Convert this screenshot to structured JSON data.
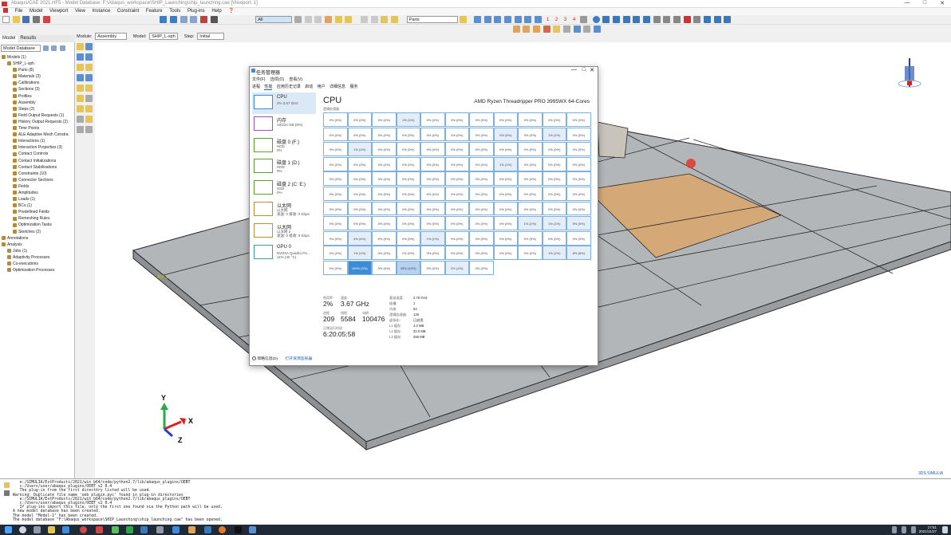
{
  "window": {
    "title": "Abaqus/CAE 2021.HF5 - Model Database: F:\\Abaqus_workspace\\SHIP_Launching\\ship_launching.cae [Viewport: 1]",
    "controls": [
      "—",
      "□",
      "✕"
    ]
  },
  "menu": [
    "File",
    "Model",
    "Viewport",
    "View",
    "Instance",
    "Constraint",
    "Feature",
    "Tools",
    "Plug-ins",
    "Help",
    "❓"
  ],
  "toolbar": {
    "filter_value": "All",
    "parts_value": "Parts",
    "view_numbers": [
      "1",
      "2",
      "3",
      "4"
    ]
  },
  "module_bar": {
    "module_label": "Module:",
    "module_value": "Assembly",
    "model_label": "Model:",
    "model_value": "SHIP_L-sph",
    "step_label": "Step:",
    "step_value": "Initial"
  },
  "tree": {
    "tabs": [
      "Model",
      "Results"
    ],
    "dropdown": "Model Database",
    "items": [
      {
        "label": "Models (1)",
        "indent": 0
      },
      {
        "label": "SHIP_L-sph",
        "indent": 1
      },
      {
        "label": "Parts (8)",
        "indent": 2
      },
      {
        "label": "Materials (3)",
        "indent": 2
      },
      {
        "label": "Calibrations",
        "indent": 2
      },
      {
        "label": "Sections (3)",
        "indent": 2
      },
      {
        "label": "Profiles",
        "indent": 2
      },
      {
        "label": "Assembly",
        "indent": 2
      },
      {
        "label": "Steps (2)",
        "indent": 2
      },
      {
        "label": "Field Output Requests (1)",
        "indent": 2
      },
      {
        "label": "History Output Requests (2)",
        "indent": 2
      },
      {
        "label": "Time Points",
        "indent": 2
      },
      {
        "label": "ALE Adaptive Mesh Constra",
        "indent": 2
      },
      {
        "label": "Interactions (1)",
        "indent": 2
      },
      {
        "label": "Interaction Properties (3)",
        "indent": 2
      },
      {
        "label": "Contact Controls",
        "indent": 2
      },
      {
        "label": "Contact Initializations",
        "indent": 2
      },
      {
        "label": "Contact Stabilizations",
        "indent": 2
      },
      {
        "label": "Constraints (10)",
        "indent": 2
      },
      {
        "label": "Connector Sections",
        "indent": 2
      },
      {
        "label": "Fields",
        "indent": 2
      },
      {
        "label": "Amplitudes",
        "indent": 2
      },
      {
        "label": "Loads (1)",
        "indent": 2
      },
      {
        "label": "BCs (1)",
        "indent": 2
      },
      {
        "label": "Predefined Fields",
        "indent": 2
      },
      {
        "label": "Remeshing Rules",
        "indent": 2
      },
      {
        "label": "Optimization Tasks",
        "indent": 2
      },
      {
        "label": "Sketches (2)",
        "indent": 2
      },
      {
        "label": "Annotations",
        "indent": 0
      },
      {
        "label": "Analysis",
        "indent": 0
      },
      {
        "label": "Jobs (1)",
        "indent": 1
      },
      {
        "label": "Adaptivity Processes",
        "indent": 1
      },
      {
        "label": "Co-executions",
        "indent": 1
      },
      {
        "label": "Optimization Processes",
        "indent": 1
      }
    ]
  },
  "viewport": {
    "triad": {
      "x": "X",
      "y": "Y",
      "z": "Z"
    },
    "label_ref": "JFP-1",
    "logo": "3DS SIMULIA",
    "colors": {
      "plate": "#b3b6b8",
      "highlight": "#d5a877",
      "edge": "#2a2a2a",
      "marker": "#e23a2a"
    }
  },
  "task_manager": {
    "title": "任务管理器",
    "menu": [
      "文件(F)",
      "选项(O)",
      "查看(V)"
    ],
    "tabs": [
      "进程",
      "性能",
      "应用历史记录",
      "启动",
      "用户",
      "详细信息",
      "服务"
    ],
    "side": [
      {
        "name": "CPU",
        "s1": "2% 3.67 GHz",
        "s2": ""
      },
      {
        "name": "内存",
        "s1": "19/224 GB (9%)",
        "s2": ""
      },
      {
        "name": "磁盘 0 (F:)",
        "s1": "HDD",
        "s2": "0%"
      },
      {
        "name": "磁盘 1 (D:)",
        "s1": "HDD",
        "s2": "0%"
      },
      {
        "name": "磁盘 2 (C: E:)",
        "s1": "SSD",
        "s2": "0%"
      },
      {
        "name": "以太网",
        "s1": "以太网",
        "s2": "发送: 0 接收: 0 Kbps"
      },
      {
        "name": "以太网",
        "s1": "以太网 2",
        "s2": "发送: 0 接收: 0 Kbps"
      },
      {
        "name": "GPU 0",
        "s1": "NVIDIA Quadro P4...",
        "s2": "11% (40 °C)"
      }
    ],
    "cpu_title": "CPU",
    "cpu_subtitle": "逻辑处理器",
    "cpu_model": "AMD Ryzen Threadripper PRO 3995WX 64-Cores",
    "grid": [
      [
        "0% (0%)",
        "0% (0%)",
        "0% (0%)",
        "1% (1%)",
        "0% (0%)",
        "0% (0%)",
        "0% (0%)",
        "0% (0%)",
        "0% (0%)",
        "0% (0%)",
        "0% (0%)"
      ],
      [
        "0% (0%)",
        "0% (0%)",
        "0% (0%)",
        "0% (0%)",
        "0% (0%)",
        "0% (0%)",
        "0% (0%)",
        "0% (0%)",
        "0% (0%)",
        "1% (1%)",
        "0% (0%)"
      ],
      [
        "0% (0%)",
        "1% (1%)",
        "0% (0%)",
        "0% (0%)",
        "0% (0%)",
        "0% (0%)",
        "0% (0%)",
        "0% (0%)",
        "0% (0%)",
        "0% (0%)",
        "0% (0%)"
      ],
      [
        "0% (0%)",
        "0% (0%)",
        "0% (0%)",
        "0% (0%)",
        "0% (0%)",
        "0% (0%)",
        "0% (0%)",
        "1% (1%)",
        "0% (0%)",
        "0% (0%)",
        "0% (0%)"
      ],
      [
        "0% (0%)",
        "0% (0%)",
        "0% (0%)",
        "0% (0%)",
        "0% (0%)",
        "0% (0%)",
        "0% (0%)",
        "0% (0%)",
        "0% (0%)",
        "0% (0%)",
        "0% (0%)"
      ],
      [
        "0% (0%)",
        "0% (0%)",
        "0% (0%)",
        "0% (0%)",
        "0% (0%)",
        "0% (0%)",
        "0% (0%)",
        "0% (0%)",
        "0% (0%)",
        "0% (0%)",
        "0% (0%)"
      ],
      [
        "0% (0%)",
        "0% (0%)",
        "0% (0%)",
        "0% (0%)",
        "0% (0%)",
        "0% (0%)",
        "0% (0%)",
        "0% (0%)",
        "0% (0%)",
        "0% (0%)",
        "0% (0%)"
      ],
      [
        "0% (0%)",
        "0% (0%)",
        "0% (0%)",
        "0% (0%)",
        "0% (0%)",
        "0% (0%)",
        "0% (0%)",
        "0% (0%)",
        "1% (1%)",
        "1% (1%)",
        "5% (5%)"
      ],
      [
        "0% (0%)",
        "4% (4%)",
        "0% (0%)",
        "0% (0%)",
        "1% (1%)",
        "0% (0%)",
        "0% (0%)",
        "0% (0%)",
        "0% (0%)",
        "0% (0%)",
        "0% (0%)"
      ],
      [
        "0% (0%)",
        "1% (1%)",
        "0% (0%)",
        "0% (0%)",
        "0% (0%)",
        "0% (0%)",
        "0% (0%)",
        "0% (0%)",
        "0% (0%)",
        "1% (1%)",
        "8% (8%)"
      ],
      [
        "0% (0%)",
        "100% (3%)",
        "0% (0%)",
        "35% (34%)",
        "0% (0%)",
        "2% (1%)",
        "0% (0%)"
      ]
    ],
    "grid_levels": [
      [
        0,
        0,
        0,
        1,
        0,
        0,
        0,
        0,
        0,
        0,
        0
      ],
      [
        0,
        0,
        0,
        0,
        0,
        0,
        0,
        1,
        0,
        1,
        0
      ],
      [
        0,
        1,
        0,
        0,
        0,
        0,
        0,
        0,
        0,
        0,
        0
      ],
      [
        0,
        0,
        0,
        0,
        0,
        0,
        0,
        1,
        0,
        0,
        0
      ],
      [
        0,
        0,
        0,
        0,
        0,
        0,
        0,
        0,
        0,
        0,
        0
      ],
      [
        0,
        0,
        0,
        0,
        0,
        0,
        0,
        0,
        0,
        0,
        0
      ],
      [
        0,
        0,
        0,
        0,
        0,
        0,
        0,
        0,
        0,
        0,
        0
      ],
      [
        0,
        0,
        0,
        0,
        0,
        0,
        0,
        0,
        1,
        1,
        1
      ],
      [
        0,
        1,
        0,
        0,
        1,
        0,
        0,
        0,
        0,
        0,
        0
      ],
      [
        0,
        1,
        0,
        0,
        0,
        0,
        0,
        0,
        0,
        1,
        1
      ],
      [
        0,
        3,
        0,
        2,
        0,
        1,
        0
      ]
    ],
    "grid_colors": [
      "#ffffff",
      "#e3eefa",
      "#b5d3f0",
      "#3c8dd8"
    ],
    "stats": {
      "util_label": "利用率",
      "util_value": "2%",
      "speed_label": "速度",
      "speed_value": "3.67 GHz",
      "proc_label": "进程",
      "proc_value": "209",
      "thread_label": "线程",
      "thread_value": "5584",
      "handle_label": "句柄",
      "handle_value": "100476",
      "uptime_label": "正常运行时间",
      "uptime_value": "6:20:05:58",
      "kv": [
        [
          "基准速度:",
          "2.70 GHz"
        ],
        [
          "插槽:",
          "1"
        ],
        [
          "内核:",
          "64"
        ],
        [
          "逻辑处理器:",
          "128"
        ],
        [
          "虚拟化:",
          "已启用"
        ],
        [
          "L1 缓存:",
          "4.0 MB"
        ],
        [
          "L2 缓存:",
          "32.0 MB"
        ],
        [
          "L3 缓存:",
          "256 MB"
        ]
      ]
    },
    "footer_less": "简略信息(D)",
    "footer_monitor": "打开资源监视器"
  },
  "messages": [
    "   e:/SIMULIA/EstProducts/2021/win_b64/code/python2.7/lib/abaqus_plugins/OEBT",
    "   c:/Users/user/abaqus_plugins/OEBT_v2 0.4",
    "   The plug-in from the first directory listed will be used.",
    "Warning: Duplicate file name 'oeb_plugin.pyc' found in plug-in directories",
    "   e:/SIMULIA/EstProducts/2021/win_b64/code/python2.7/lib/abaqus_plugins/OEBT",
    "   c:/Users/user/abaqus_plugins/OEBT_v2 0.4",
    "   If plug-ins import this file, only the first one found via the Python path will be used.",
    "A new model database has been created.",
    "The model \"Model-1\" has been created.",
    "The model database \"F:\\Abaqus_workspace\\SHIP_Launching\\ship_launching.cae\" has been opened."
  ],
  "taskbar": {
    "time": "17:51",
    "date": "2021/11/27"
  }
}
